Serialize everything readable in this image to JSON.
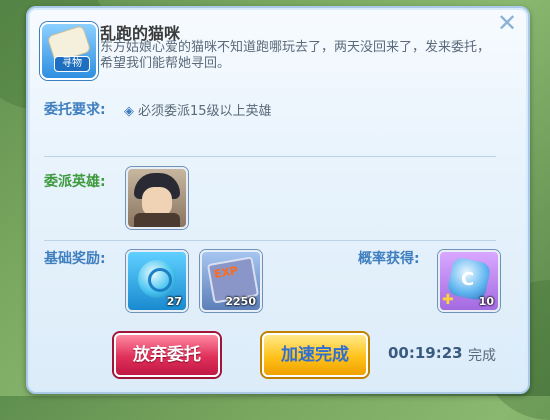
{
  "task": {
    "icon_tag": "寻物",
    "title": "乱跑的猫咪",
    "description": "东方姑娘心爱的猫咪不知道跑哪玩去了，两天没回来了，发来委托，希望我们能帮她寻回。"
  },
  "requirement": {
    "label": "委托要求:",
    "text": "必须委派15级以上英雄"
  },
  "hero": {
    "label": "委派英雄:"
  },
  "rewards": {
    "base_label": "基础奖励:",
    "chance_label": "概率获得:",
    "items": [
      {
        "icon": "crystal-orb-icon",
        "count": "27"
      },
      {
        "icon": "exp-book-icon",
        "count": "2250",
        "badge": "EXP"
      },
      {
        "icon": "gem-puzzle-icon",
        "count": "10"
      }
    ]
  },
  "actions": {
    "abandon_label": "放弃委托",
    "speed_label": "加速完成"
  },
  "timer": {
    "time": "00:19:23",
    "status": "完成"
  },
  "close_symbol": "✕",
  "colors": {
    "panel_bg": "#e8f3fc",
    "label_blue": "#3f7fc0",
    "label_green": "#3d9a3d",
    "abandon_red": "#e0305a",
    "speed_gold": "#ffc21a"
  }
}
